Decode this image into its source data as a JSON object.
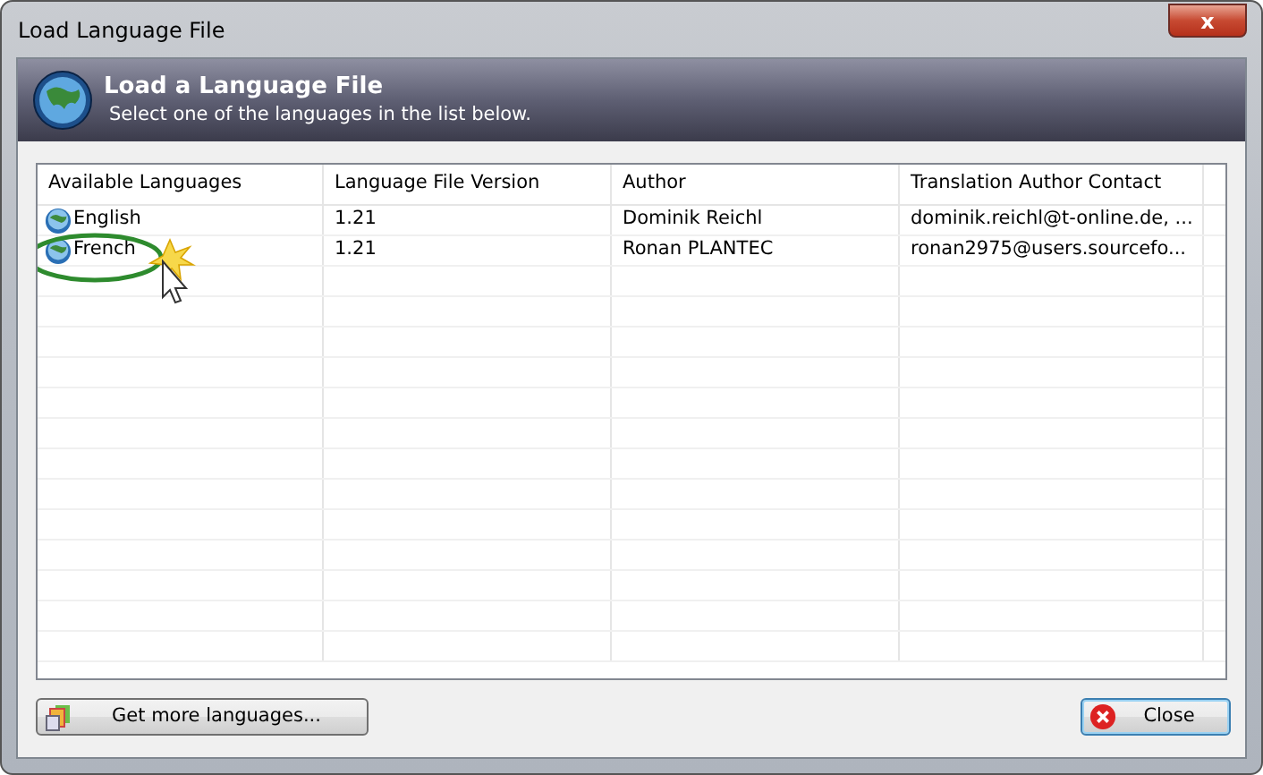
{
  "window": {
    "title": "Load Language File",
    "close_glyph": "x"
  },
  "header": {
    "title": "Load a Language File",
    "subtitle": "Select one of the languages in the list below."
  },
  "table": {
    "columns": [
      "Available Languages",
      "Language File Version",
      "Author",
      "Translation Author Contact"
    ],
    "rows": [
      {
        "cells": [
          "English",
          "1.21",
          "Dominik Reichl",
          "dominik.reichl@t-online.de, ..."
        ],
        "highlighted": false
      },
      {
        "cells": [
          "French",
          "1.21",
          "Ronan PLANTEC",
          "ronan2975@users.sourcefo..."
        ],
        "highlighted": true
      }
    ]
  },
  "buttons": [
    {
      "label": "Get more languages...",
      "kind": "more",
      "default": false
    },
    {
      "label": "Close",
      "kind": "close",
      "default": true
    }
  ]
}
